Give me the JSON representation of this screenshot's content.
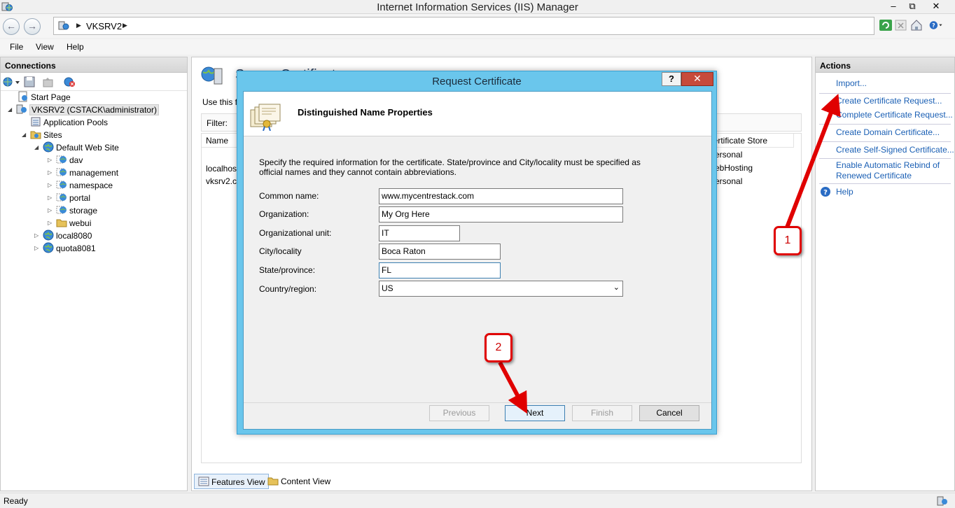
{
  "window": {
    "title": "Internet Information Services (IIS) Manager",
    "minimize": "–",
    "restore": "⧉",
    "close": "✕"
  },
  "address": {
    "crumb": "VKSRV2"
  },
  "menu": {
    "file": "File",
    "view": "View",
    "help": "Help"
  },
  "connections": {
    "header": "Connections",
    "tree": [
      {
        "label": "Start Page",
        "icon": "start-page-icon"
      },
      {
        "label": "VKSRV2 (CSTACK\\administrator)",
        "icon": "server-icon"
      },
      {
        "label": "Application Pools",
        "icon": "app-pools-icon"
      },
      {
        "label": "Sites",
        "icon": "sites-folder-icon"
      },
      {
        "label": "Default Web Site",
        "icon": "globe-icon"
      },
      {
        "label": "dav",
        "icon": "web-app-icon"
      },
      {
        "label": "management",
        "icon": "web-app-icon"
      },
      {
        "label": "namespace",
        "icon": "web-app-icon"
      },
      {
        "label": "portal",
        "icon": "web-app-icon"
      },
      {
        "label": "storage",
        "icon": "web-app-icon"
      },
      {
        "label": "webui",
        "icon": "folder-icon"
      },
      {
        "label": "local8080",
        "icon": "globe-icon"
      },
      {
        "label": "quota8081",
        "icon": "globe-icon"
      }
    ]
  },
  "center": {
    "heading": "Server Certificates",
    "desc": "Use this f",
    "filter_label": "Filter:",
    "col_name": "Name",
    "col_store": "Certificate Store",
    "rows": [
      {
        "name": "localhost",
        "store": "Personal"
      },
      {
        "name": "vksrv2.cs",
        "store": "WebHosting"
      },
      {
        "name": "",
        "store": "Personal"
      }
    ],
    "store_texts": [
      "ersonal",
      "ebHosting",
      "ersonal"
    ],
    "name_texts": [
      "localhos",
      "vksrv2.cs"
    ]
  },
  "bottom_tabs": {
    "features": "Features View",
    "content": "Content View"
  },
  "actions": {
    "header": "Actions",
    "items": [
      "Import...",
      "Create Certificate Request...",
      "Complete Certificate Request...",
      "Create Domain Certificate...",
      "Create Self-Signed Certificate...",
      "Enable Automatic Rebind of",
      "Renewed Certificate",
      "Help"
    ]
  },
  "status": {
    "text": "Ready"
  },
  "dialog": {
    "title": "Request Certificate",
    "help": "?",
    "close": "✕",
    "band_title": "Distinguished Name Properties",
    "instructions": "Specify the required information for the certificate. State/province and City/locality must be specified as official names and they cannot contain abbreviations.",
    "fields": [
      {
        "label": "Common name:",
        "value": "www.mycentrestack.com"
      },
      {
        "label": "Organization:",
        "value": "My Org Here"
      },
      {
        "label": "Organizational unit:",
        "value": "IT"
      },
      {
        "label": "City/locality",
        "value": "Boca Raton"
      },
      {
        "label": "State/province:",
        "value": "FL"
      },
      {
        "label": "Country/region:",
        "value": "US"
      }
    ],
    "buttons": {
      "previous": "Previous",
      "next": "Next",
      "finish": "Finish",
      "cancel": "Cancel"
    }
  },
  "annotations": {
    "one": "1",
    "two": "2",
    "arrow_color": "#e00000"
  }
}
